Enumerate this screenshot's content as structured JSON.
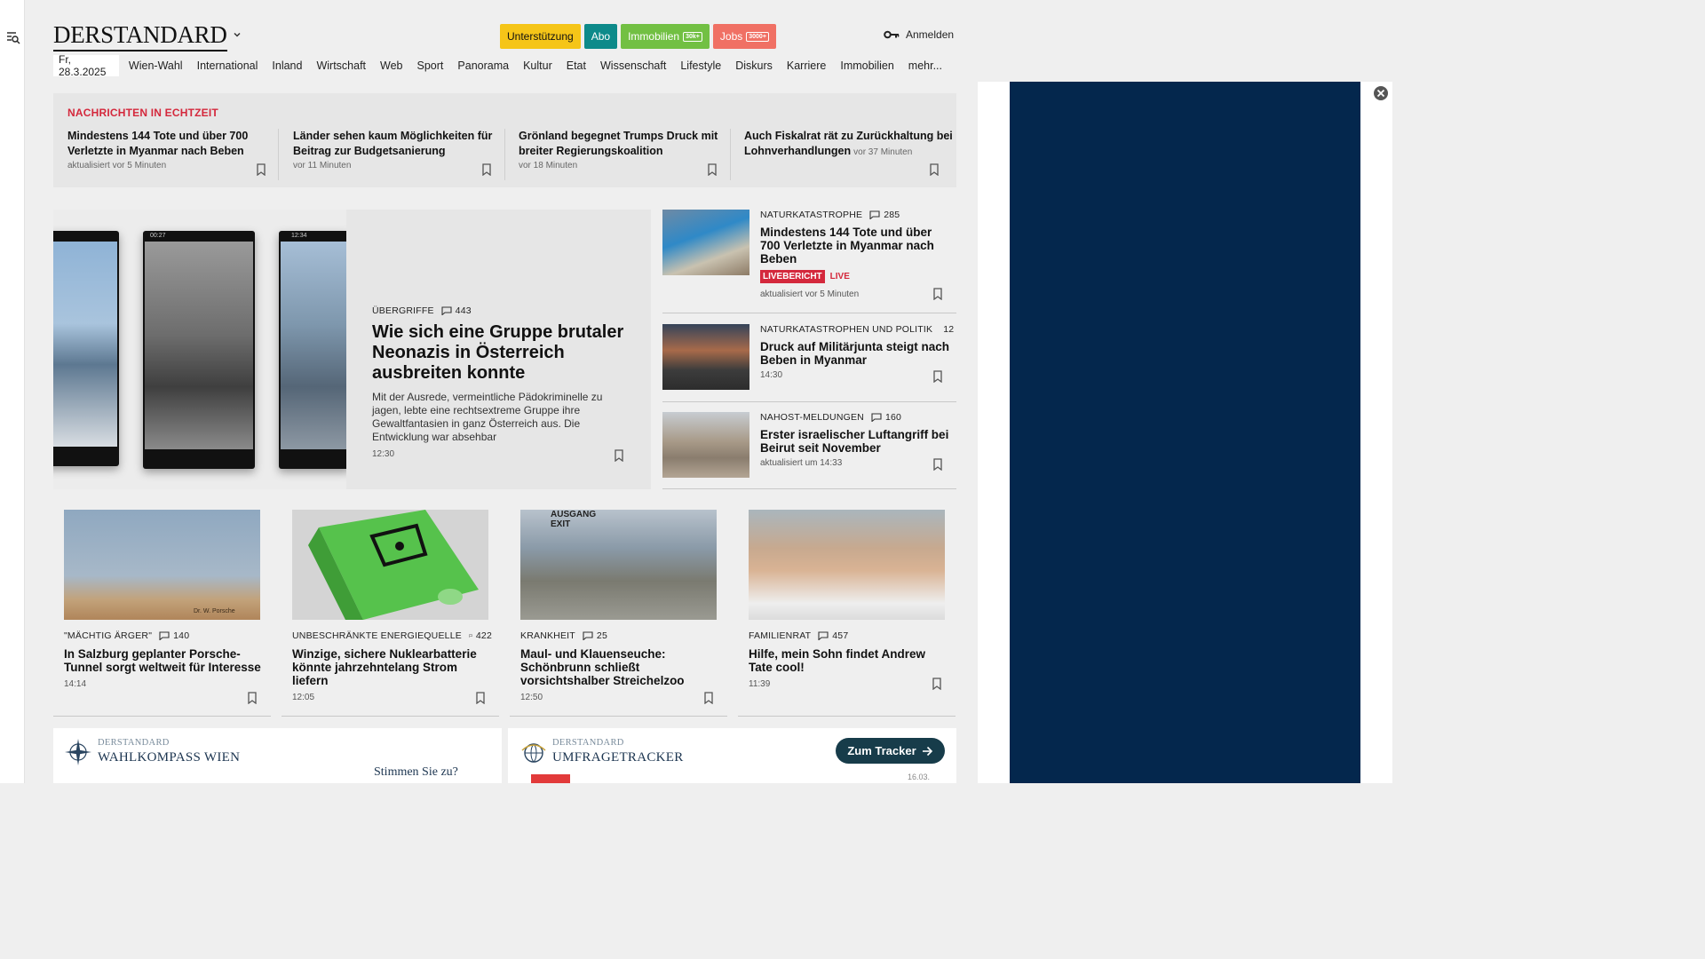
{
  "header": {
    "logo": "DERSTANDARD",
    "pills": [
      {
        "label": "Unterstützung",
        "badge": "",
        "bg": "#f5c518",
        "fg": "#111111"
      },
      {
        "label": "Abo",
        "badge": "",
        "bg": "#0d8a8a",
        "fg": "#ffffff"
      },
      {
        "label": "Immobilien",
        "badge": "30k+",
        "bg": "#72c043",
        "fg": "#ffffff"
      },
      {
        "label": "Jobs",
        "badge": "3000+",
        "bg": "#f07064",
        "fg": "#ffffff"
      }
    ],
    "login_label": "Anmelden"
  },
  "nav": {
    "date": "Fr, 28.3.2025",
    "items": [
      "Wien-Wahl",
      "International",
      "Inland",
      "Wirtschaft",
      "Web",
      "Sport",
      "Panorama",
      "Kultur",
      "Etat",
      "Wissenschaft",
      "Lifestyle",
      "Diskurs",
      "Karriere",
      "Immobilien",
      "mehr..."
    ]
  },
  "ticker": {
    "heading": "NACHRICHTEN IN ECHTZEIT",
    "items": [
      {
        "title": "Mindestens 144 Tote und über 700 Verletzte in Myanmar nach Beben",
        "meta": "aktualisiert vor 5 Minuten"
      },
      {
        "title": "Länder sehen kaum Möglichkeiten für Beitrag zur Budgetsanierung",
        "meta": "vor 11 Minuten"
      },
      {
        "title": "Grönland begegnet Trumps Druck mit breiter Regierungskoalition",
        "meta": "vor 18 Minuten"
      },
      {
        "title": "Auch Fiskalrat rät zu Zurückhaltung bei Lohnverhandlungen",
        "meta": "vor 37 Minuten"
      }
    ]
  },
  "hero": {
    "kicker": "ÜBERGRIFFE",
    "comments": "443",
    "title": "Wie sich eine Gruppe brutaler Neonazis in Österreich ausbreiten konnte",
    "teaser": "Mit der Ausrede, vermeintliche Pädokriminelle zu jagen, lebte eine rechtsextreme Gruppe ihre Gewaltfantasien in ganz Österreich aus. Die Entwicklung war absehbar",
    "time": "12:30",
    "phone_times": [
      "",
      "00:27",
      "12:34"
    ]
  },
  "side": [
    {
      "kicker": "NATURKATASTROPHE",
      "comments": "285",
      "title": "Mindestens 144 Tote und über 700 Verletzte in Myanmar nach Beben",
      "live_badge": "LIVEBERICHT",
      "live_text": "LIVE",
      "time": "aktualisiert vor 5 Minuten"
    },
    {
      "kicker": "NATURKATASTROPHEN UND POLITIK",
      "comments": "12",
      "title": "Druck auf Militärjunta steigt nach Beben in Myanmar",
      "time": "14:30"
    },
    {
      "kicker": "NAHOST-MELDUNGEN",
      "comments": "160",
      "title": "Erster israelischer Luftangriff bei Beirut seit November",
      "time": "aktualisiert um 14:33"
    }
  ],
  "cards": [
    {
      "kicker": "\"MÄCHTIG ÄRGER\"",
      "comments": "140",
      "title": "In Salzburg geplanter Porsche-Tunnel sorgt weltweit für Interesse",
      "time": "14:14",
      "img_caption": "Dr. W. Porsche"
    },
    {
      "kicker": "UNBESCHRÄNKTE ENERGIEQUELLE",
      "comments": "422",
      "title": "Winzige, sichere Nuklearbatterie könnte jahrzehntelang Strom liefern",
      "time": "12:05"
    },
    {
      "kicker": "KRANKHEIT",
      "comments": "25",
      "title": "Maul- und Klauenseuche: Schönbrunn schließt vorsichtshalber Streichelzoo",
      "time": "12:50",
      "img_caption": "AUSGANG EXIT"
    },
    {
      "kicker": "FAMILIENRAT",
      "comments": "457",
      "title": "Hilfe, mein Sohn findet Andrew Tate cool!",
      "time": "11:39"
    }
  ],
  "boxes": {
    "wahlkompass": {
      "brand": "DERSTANDARD",
      "name": "WAHLKOMPASS WIEN",
      "cta": "Stimmen Sie zu?"
    },
    "umfrage": {
      "brand": "DERSTANDARD",
      "name": "UMFRAGETRACKER",
      "button": "Zum Tracker",
      "date": "16.03."
    }
  }
}
